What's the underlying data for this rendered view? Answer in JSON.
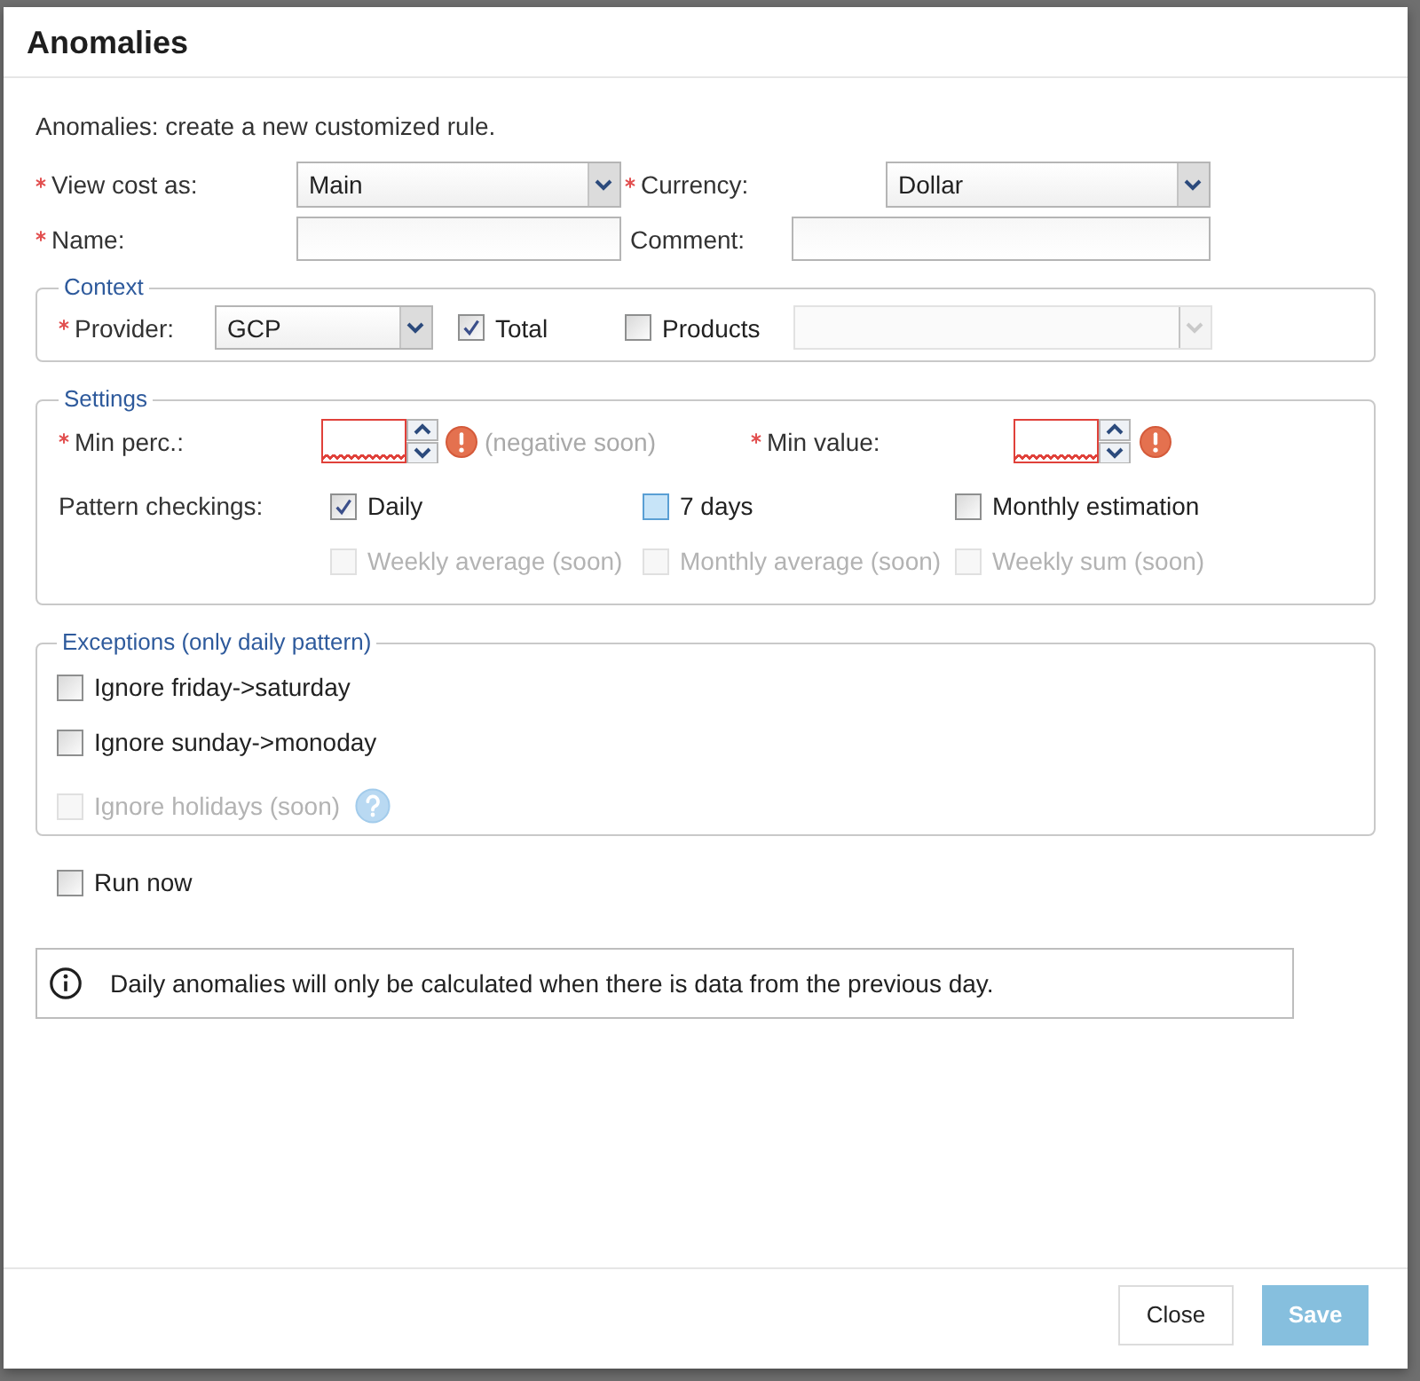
{
  "dialog": {
    "title": "Anomalies"
  },
  "intro": "Anomalies: create a new customized rule.",
  "fields": [
    {
      "kind": "select",
      "label": "View cost as:",
      "required": true,
      "value": "Main"
    },
    {
      "kind": "select",
      "label": "Currency:",
      "required": true,
      "value": "Dollar"
    },
    {
      "kind": "text",
      "label": "Name:",
      "required": true
    },
    {
      "kind": "text",
      "label": "Comment:",
      "required": false
    }
  ],
  "context": {
    "legend": "Context",
    "provider": {
      "label": "Provider:",
      "required": true,
      "value": "GCP"
    },
    "options": [
      {
        "label": "Total",
        "checked": true
      },
      {
        "label": "Products",
        "checked": false
      }
    ],
    "products_dropdown": {
      "disabled": true
    }
  },
  "settings": {
    "legend": "Settings",
    "numbers": [
      {
        "label": "Min perc.:",
        "required": true,
        "invalid": true,
        "hint": "(negative soon)"
      },
      {
        "label": "Min value:",
        "required": true,
        "invalid": true
      }
    ],
    "patterns_label": "Pattern checkings:",
    "patterns": [
      {
        "label": "Daily",
        "checked": true,
        "hovered": false,
        "disabled": false
      },
      {
        "label": "7 days",
        "checked": false,
        "hovered": true,
        "disabled": false
      },
      {
        "label": "Monthly estimation",
        "checked": false,
        "hovered": false,
        "disabled": false
      },
      {
        "label": "Weekly average (soon)",
        "checked": false,
        "hovered": false,
        "disabled": true
      },
      {
        "label": "Monthly average (soon)",
        "checked": false,
        "hovered": false,
        "disabled": true
      },
      {
        "label": "Weekly sum (soon)",
        "checked": false,
        "hovered": false,
        "disabled": true
      }
    ]
  },
  "exceptions": {
    "legend": "Exceptions (only daily pattern)",
    "items": [
      {
        "label": "Ignore friday->saturday",
        "checked": false,
        "disabled": false,
        "help": false
      },
      {
        "label": "Ignore sunday->monoday",
        "checked": false,
        "disabled": false,
        "help": false
      },
      {
        "label": "Ignore holidays (soon)",
        "checked": false,
        "disabled": true,
        "help": true
      }
    ]
  },
  "run_now": {
    "label": "Run now",
    "checked": false
  },
  "info": {
    "text": "Daily anomalies will only be calculated when there is data from the previous day."
  },
  "buttons": [
    {
      "label": "Close",
      "kind": "secondary",
      "disabled": false
    },
    {
      "label": "Save",
      "kind": "primary",
      "disabled": true
    }
  ]
}
